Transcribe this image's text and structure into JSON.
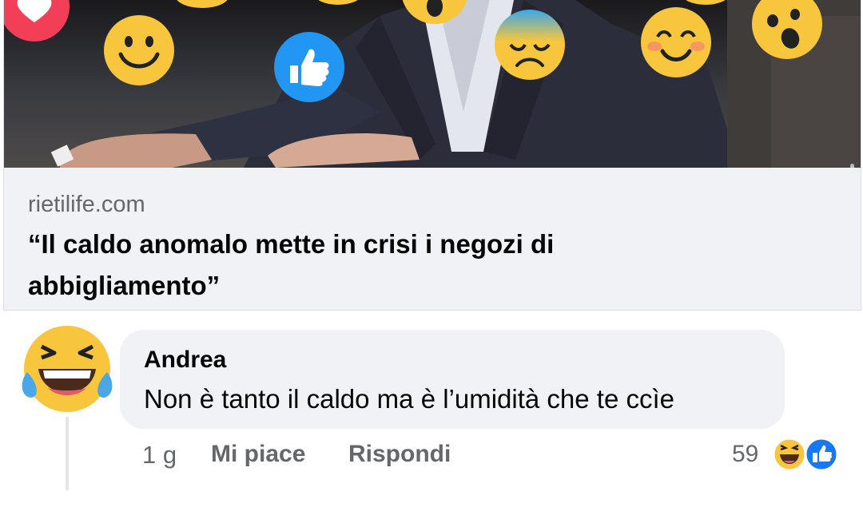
{
  "link_preview": {
    "domain": "rietilife.com",
    "title": "“Il caldo anomalo mette in crisi i negozi di abbigliamento”"
  },
  "comment": {
    "author": "Andrea",
    "text": "Non è tanto il caldo ma è l’umidità che te ccìe",
    "time": "1 g",
    "like_label": "Mi piace",
    "reply_label": "Rispondi",
    "reaction_count": "59",
    "reactions": [
      "haha-icon",
      "like-icon"
    ]
  },
  "colors": {
    "bubble_bg": "#f0f2f5",
    "secondary_text": "#65676b",
    "like_blue": "#1877f2",
    "emoji_yellow": "#f7c63c",
    "heart_red": "#f33e58"
  }
}
